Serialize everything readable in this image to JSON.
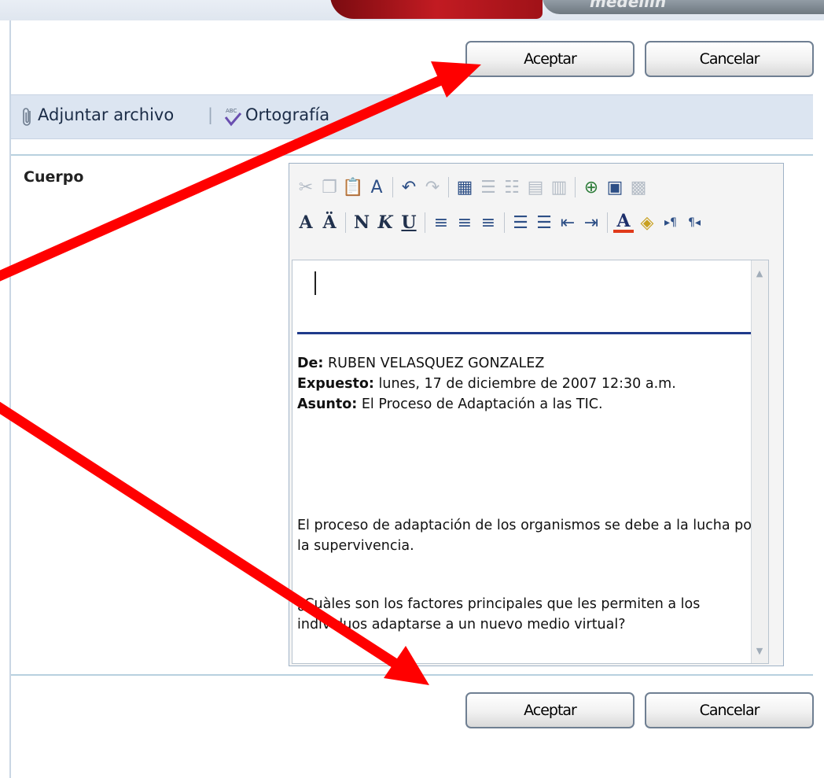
{
  "banner": {
    "watermark_text": "medellin"
  },
  "top_buttons": {
    "accept_label": "Aceptar",
    "cancel_label": "Cancelar"
  },
  "bottom_buttons": {
    "accept_label": "Aceptar",
    "cancel_label": "Cancelar"
  },
  "attach_bar": {
    "attach_label": "Adjuntar archivo",
    "separator": "|",
    "spell_label": "Ortografía",
    "icons": [
      "paperclip-icon",
      "spellcheck-icon"
    ]
  },
  "form": {
    "body_label": "Cuerpo"
  },
  "editor": {
    "toolbar_row1": [
      "cut-icon",
      "copy-icon",
      "paste-icon",
      "paste-text-icon",
      "undo-icon",
      "redo-icon",
      "table-icon",
      "insert-row-icon",
      "insert-column-icon",
      "merge-cells-icon",
      "split-cells-icon",
      "hyperlink-icon",
      "insert-image-icon",
      "insert-asset-icon"
    ],
    "toolbar_row2": [
      "font-size-icon",
      "font-style-icon",
      "bold-icon",
      "italic-icon",
      "underline-icon",
      "align-left-icon",
      "align-center-icon",
      "align-right-icon",
      "numbered-list-icon",
      "bulleted-list-icon",
      "decrease-indent-icon",
      "increase-indent-icon",
      "text-color-icon",
      "highlight-icon",
      "ltr-icon",
      "rtl-icon"
    ],
    "from_label": "De:",
    "from_value": "RUBEN VELASQUEZ GONZALEZ",
    "posted_label": "Expuesto:",
    "posted_value": "lunes, 17 de diciembre de 2007 12:30 a.m.",
    "subject_label": "Asunto:",
    "subject_value": "El Proceso de Adaptación a las TIC.",
    "paragraph1": "El proceso de adaptación de los organismos se debe a la lucha por la supervivencia.",
    "paragraph2": "¿Cuàles son los factores principales que les permiten a los individuos adaptarse  a un nuevo medio virtual?"
  },
  "colors": {
    "arrow": "#ff0000",
    "bar_bg": "#dce5f1",
    "rule": "#1f3a8a"
  }
}
